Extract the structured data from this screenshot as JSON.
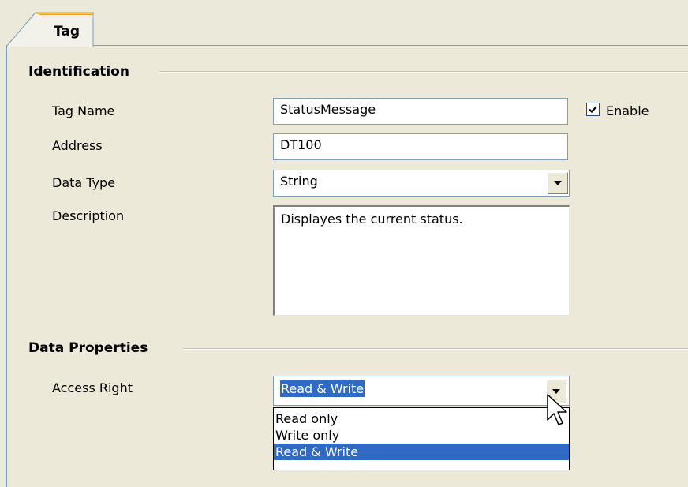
{
  "tab": {
    "label": "Tag"
  },
  "identification": {
    "title": "Identification",
    "tag_name_label": "Tag Name",
    "tag_name_value": "StatusMessage",
    "enable_label": "Enable",
    "enable_checked": true,
    "address_label": "Address",
    "address_value": "DT100",
    "data_type_label": "Data Type",
    "data_type_value": "String",
    "description_label": "Description",
    "description_value": "Displayes the current status."
  },
  "data_properties": {
    "title": "Data Properties",
    "access_right_label": "Access Right",
    "access_right_value": "Read & Write",
    "options": [
      "Read only",
      "Write only",
      "Read & Write"
    ],
    "selected_option": "Read & Write"
  },
  "colors": {
    "background": "#ece9d8",
    "selection": "#316ac5",
    "input_border": "#7f9db9"
  },
  "icons": {
    "cursor": "arrow-pointer-icon",
    "dropdown": "chevron-down-icon",
    "check": "checkmark-icon"
  }
}
